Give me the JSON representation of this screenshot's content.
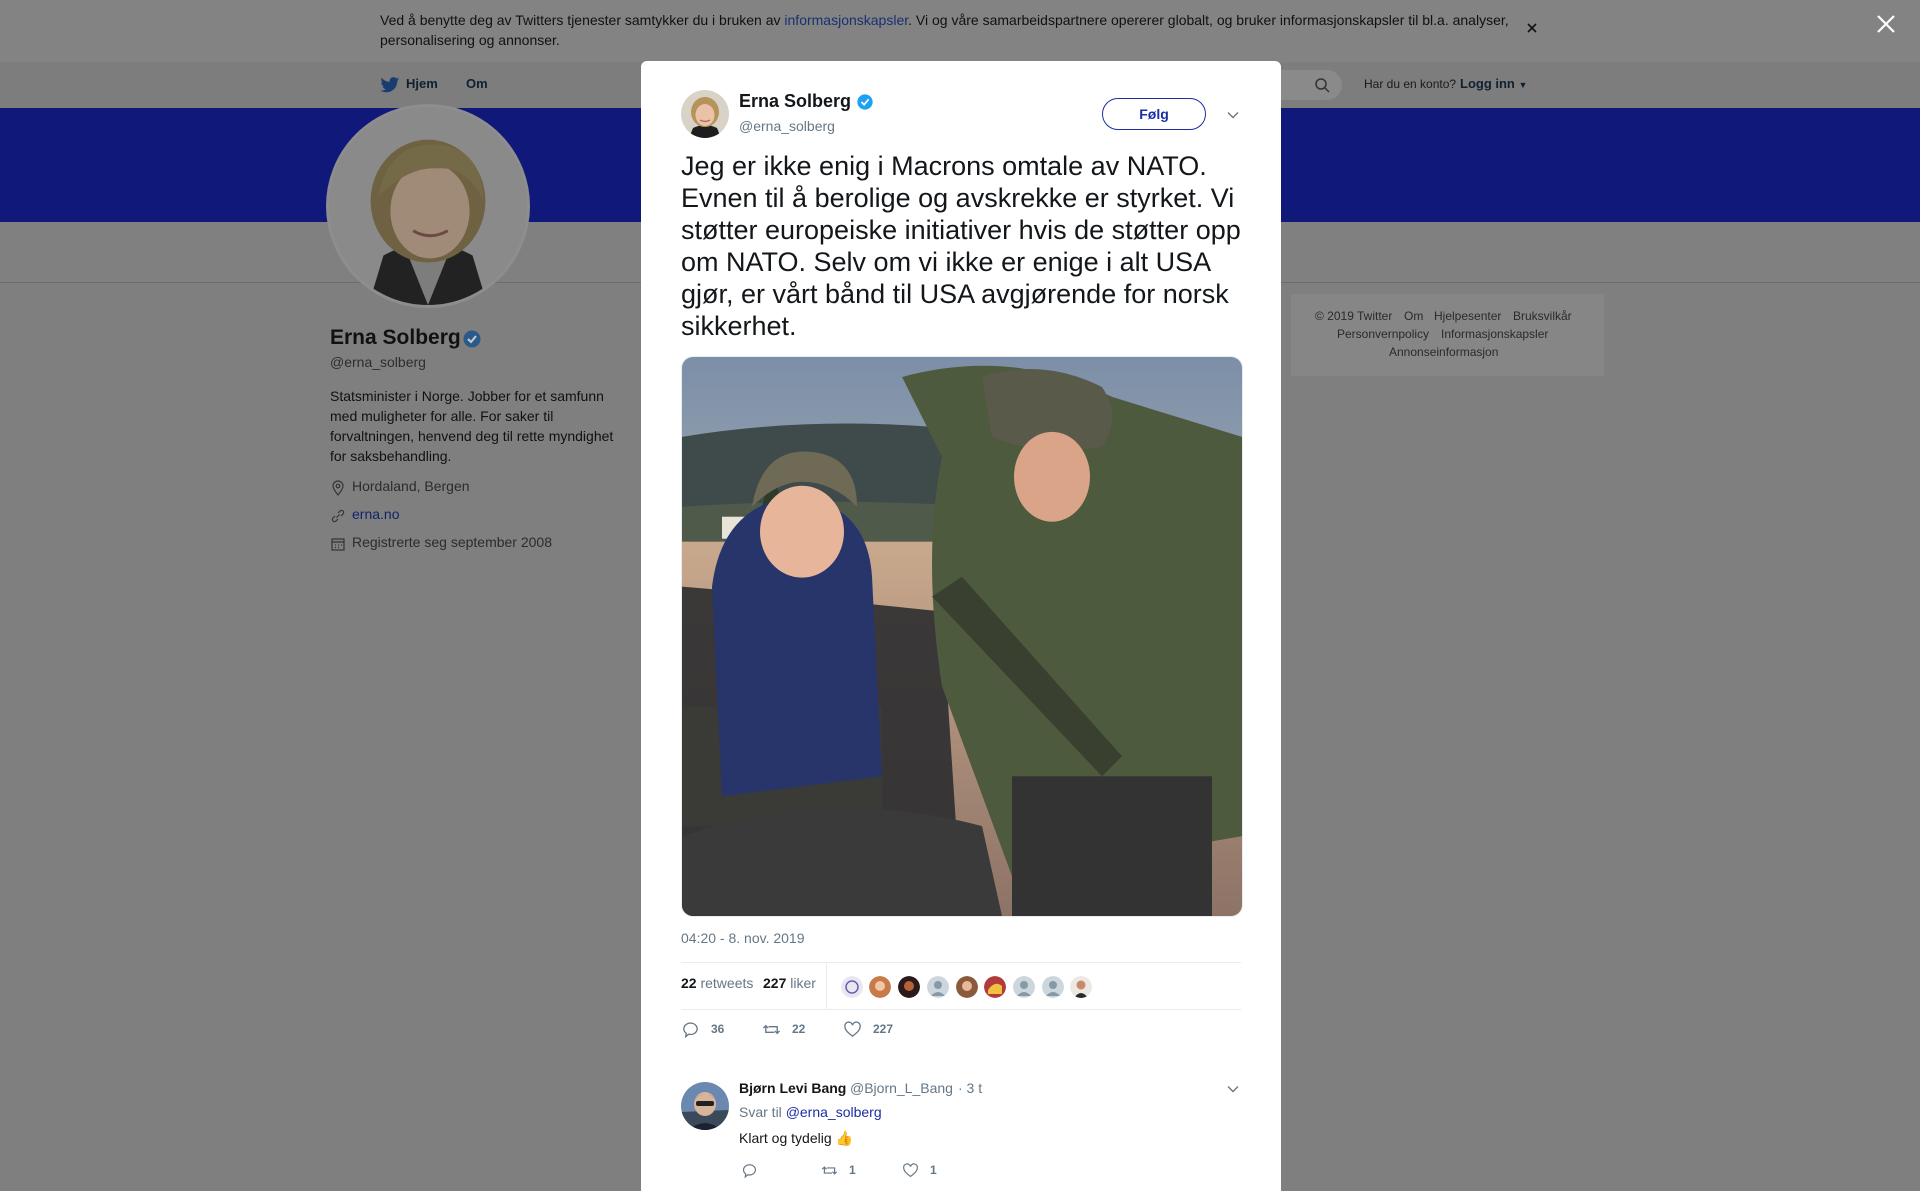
{
  "cookie_banner": {
    "text_before": "Ved å benytte deg av Twitters tjenester samtykker du i bruken av ",
    "link": "informasjonskapsler",
    "text_after": ". Vi og våre samarbeidspartnere opererer globalt, og bruker informasjonskapsler til bl.a. analyser, personalisering og annonser."
  },
  "nav": {
    "home": "Hjem",
    "about": "Om",
    "account_question": "Har du en konto?",
    "login": "Logg inn"
  },
  "profile": {
    "name": "Erna Solberg",
    "handle": "@erna_solberg",
    "bio": "Statsminister i Norge. Jobber for et samfunn med muligheter for alle. For saker til forvaltningen, henvend deg til rette myndighet for saksbehandling.",
    "location": "Hordaland, Bergen",
    "website": "erna.no",
    "joined": "Registrerte seg september 2008"
  },
  "footer": {
    "copyright": "© 2019 Twitter",
    "about": "Om",
    "help": "Hjelpesenter",
    "terms": "Bruksvilkår",
    "privacy": "Personvernpolicy",
    "cookies": "Informasjonskapsler",
    "ads": "Annonseinformasjon"
  },
  "tweet": {
    "author_name": "Erna Solberg",
    "author_handle": "@erna_solberg",
    "follow_label": "Følg",
    "text": "Jeg er ikke enig i Macrons omtale av NATO. Evnen til å berolige og avskrekke er styrket. Vi støtter europeiske initiativer hvis de støtter opp om NATO. Selv om vi ikke er enige i alt USA gjør, er vårt bånd til USA avgjørende for norsk sikkerhet.",
    "timestamp": "04:20 - 8. nov. 2019",
    "retweets": "22",
    "retweets_label": "retweets",
    "likes": "227",
    "likes_label": "liker",
    "replies_count": "36",
    "retweet_count": "22",
    "like_count": "227"
  },
  "reply": {
    "name": "Bjørn Levi Bang",
    "handle": "@Bjorn_L_Bang",
    "time": "· 3 t",
    "reply_to_label": "Svar til",
    "reply_to_handle": "@erna_solberg",
    "text": "Klart og tydelig 👍",
    "retweet_count": "1",
    "like_count": "1"
  },
  "colors": {
    "banner": "#10197a",
    "accent": "#1b2ea3",
    "verified": "#1da1f2",
    "muted": "#657786"
  }
}
